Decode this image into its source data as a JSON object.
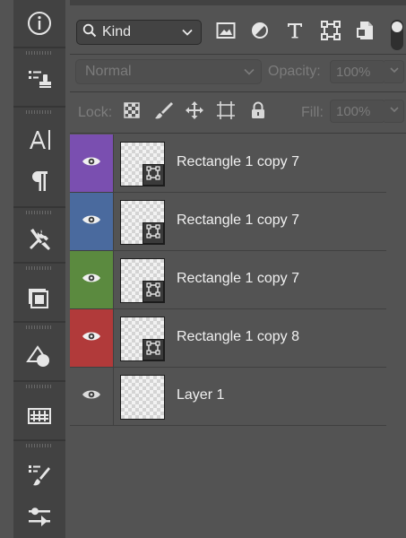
{
  "toolbar": {
    "tools": [
      {
        "icon": "info-icon"
      },
      {
        "icon": "clone-stamp-list-icon"
      },
      {
        "icon": "character-icon"
      },
      {
        "icon": "paragraph-icon"
      },
      {
        "icon": "tool-presets-icon"
      },
      {
        "icon": "libraries-icon"
      },
      {
        "icon": "shapes-icon"
      },
      {
        "icon": "glyphs-icon"
      },
      {
        "icon": "brush-settings-icon"
      },
      {
        "icon": "adjustments-sliders-icon"
      }
    ]
  },
  "filter": {
    "kind_label": "Kind",
    "icons": [
      "image-filter-icon",
      "adjustment-filter-icon",
      "type-filter-icon",
      "shape-filter-icon",
      "smart-object-filter-icon"
    ]
  },
  "blend": {
    "mode": "Normal",
    "opacity_label": "Opacity:",
    "opacity_value": "100%"
  },
  "lock": {
    "label": "Lock:",
    "fill_label": "Fill:",
    "fill_value": "100%"
  },
  "layers": [
    {
      "name": "Rectangle 1 copy 7",
      "color": "#7a4fb0",
      "shape": true
    },
    {
      "name": "Rectangle 1 copy 7",
      "color": "#4a6a9e",
      "shape": true
    },
    {
      "name": "Rectangle 1 copy 7",
      "color": "#5b8a3f",
      "shape": true
    },
    {
      "name": "Rectangle 1 copy 8",
      "color": "#b13a3a",
      "shape": true
    },
    {
      "name": "Layer 1",
      "color": "",
      "shape": false
    }
  ]
}
